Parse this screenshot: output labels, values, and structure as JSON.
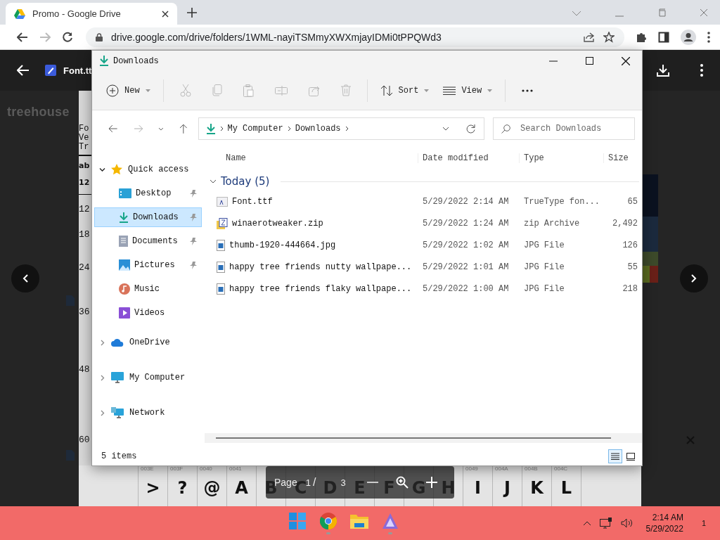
{
  "browser": {
    "tab": {
      "title": "Promo - Google Drive"
    },
    "url": "drive.google.com/drive/folders/1WML-nayiTSMmyXWXmjayIDMi0tPPQWd3"
  },
  "drive_list": {
    "label": "treehouse"
  },
  "viewer": {
    "file_name": "Font.tt",
    "document": {
      "header_lines": [
        "Fo",
        "Ve",
        "Tr"
      ],
      "samples": [
        "ab",
        "12"
      ],
      "sizes": [
        "12",
        "18",
        "24",
        "36",
        "48",
        "60"
      ],
      "glyphs": [
        {
          "code": "003E",
          "char": ">"
        },
        {
          "code": "003F",
          "char": "?"
        },
        {
          "code": "0040",
          "char": "@"
        },
        {
          "code": "0041",
          "char": "A"
        },
        {
          "char": "B"
        },
        {
          "char": "C"
        },
        {
          "char": "D"
        },
        {
          "char": "E"
        },
        {
          "char": "F"
        },
        {
          "char": "G"
        },
        {
          "char": "H"
        },
        {
          "code": "0049",
          "char": "I"
        },
        {
          "code": "004A",
          "char": "J"
        },
        {
          "code": "004B",
          "char": "K"
        },
        {
          "code": "004C",
          "char": "L"
        }
      ]
    },
    "page_control": {
      "label": "Page",
      "current": "1",
      "separator": "/",
      "total": "3"
    }
  },
  "explorer": {
    "title": "Downloads",
    "toolbar": {
      "new": "New",
      "sort": "Sort",
      "view": "View"
    },
    "address": {
      "path": [
        "My Computer",
        "Downloads"
      ],
      "search_placeholder": "Search Downloads"
    },
    "nav": [
      {
        "label": "Quick access",
        "expanded": true,
        "selected": false,
        "children": [
          {
            "label": "Desktop",
            "pinned": true,
            "selected": false
          },
          {
            "label": "Downloads",
            "pinned": true,
            "selected": true
          },
          {
            "label": "Documents",
            "pinned": true,
            "selected": false
          },
          {
            "label": "Pictures",
            "pinned": true,
            "selected": false
          },
          {
            "label": "Music",
            "pinned": false,
            "selected": false
          },
          {
            "label": "Videos",
            "pinned": false,
            "selected": false
          }
        ]
      },
      {
        "label": "OneDrive",
        "expanded": false,
        "selected": false
      },
      {
        "label": "My Computer",
        "expanded": false,
        "selected": false
      },
      {
        "label": "Network",
        "expanded": false,
        "selected": false
      }
    ],
    "columns": [
      "Name",
      "Date modified",
      "Type",
      "Size"
    ],
    "group": {
      "label": "Today (5)",
      "expanded": true
    },
    "files": [
      {
        "name": "Font.ttf",
        "date": "5/29/2022 2:14 AM",
        "type": "TrueType fon...",
        "size": "65"
      },
      {
        "name": "winaerotweaker.zip",
        "date": "5/29/2022 1:24 AM",
        "type": "zip Archive",
        "size": "2,492"
      },
      {
        "name": "thumb-1920-444664.jpg",
        "date": "5/29/2022 1:02 AM",
        "type": "JPG File",
        "size": "126"
      },
      {
        "name": "happy tree friends nutty wallpape...",
        "date": "5/29/2022 1:01 AM",
        "type": "JPG File",
        "size": "55"
      },
      {
        "name": "happy tree friends flaky wallpape...",
        "date": "5/29/2022 1:00 AM",
        "type": "JPG File",
        "size": "218"
      }
    ],
    "status": "5 items",
    "view_modes": [
      {
        "selected": true
      },
      {
        "selected": false
      }
    ]
  },
  "taskbar": {
    "apps": [
      {
        "running": false
      },
      {
        "running": true
      },
      {
        "running": false
      },
      {
        "running": true
      }
    ],
    "time": "2:14 AM",
    "date": "5/29/2022",
    "notification_count": "1"
  }
}
